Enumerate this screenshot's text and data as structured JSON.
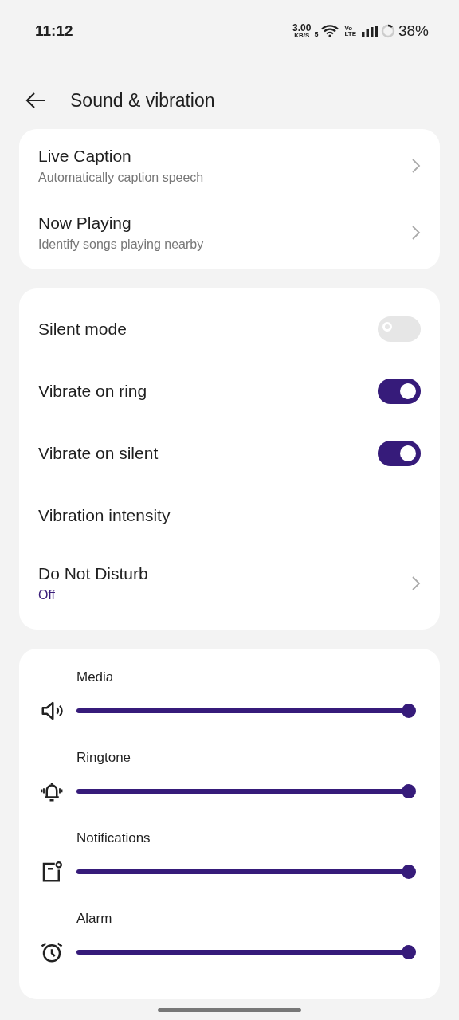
{
  "status_bar": {
    "time": "11:12",
    "net_speed": "3.00",
    "net_unit": "KB/S",
    "wifi_band": "5",
    "volte_top": "Vo",
    "volte_bottom": "LTE",
    "battery": "38%"
  },
  "header": {
    "title": "Sound & vibration"
  },
  "links": [
    {
      "title": "Live Caption",
      "subtitle": "Automatically caption speech"
    },
    {
      "title": "Now Playing",
      "subtitle": "Identify songs playing nearby"
    }
  ],
  "settings": [
    {
      "kind": "switch",
      "title": "Silent mode",
      "on": false
    },
    {
      "kind": "switch",
      "title": "Vibrate on ring",
      "on": true
    },
    {
      "kind": "switch",
      "title": "Vibrate on silent",
      "on": true
    },
    {
      "kind": "plain",
      "title": "Vibration intensity"
    },
    {
      "kind": "link",
      "title": "Do Not Disturb",
      "value": "Off"
    }
  ],
  "volumes": [
    {
      "label": "Media",
      "level": 1
    },
    {
      "label": "Ringtone",
      "level": 1
    },
    {
      "label": "Notifications",
      "level": 1
    },
    {
      "label": "Alarm",
      "level": 1
    }
  ]
}
